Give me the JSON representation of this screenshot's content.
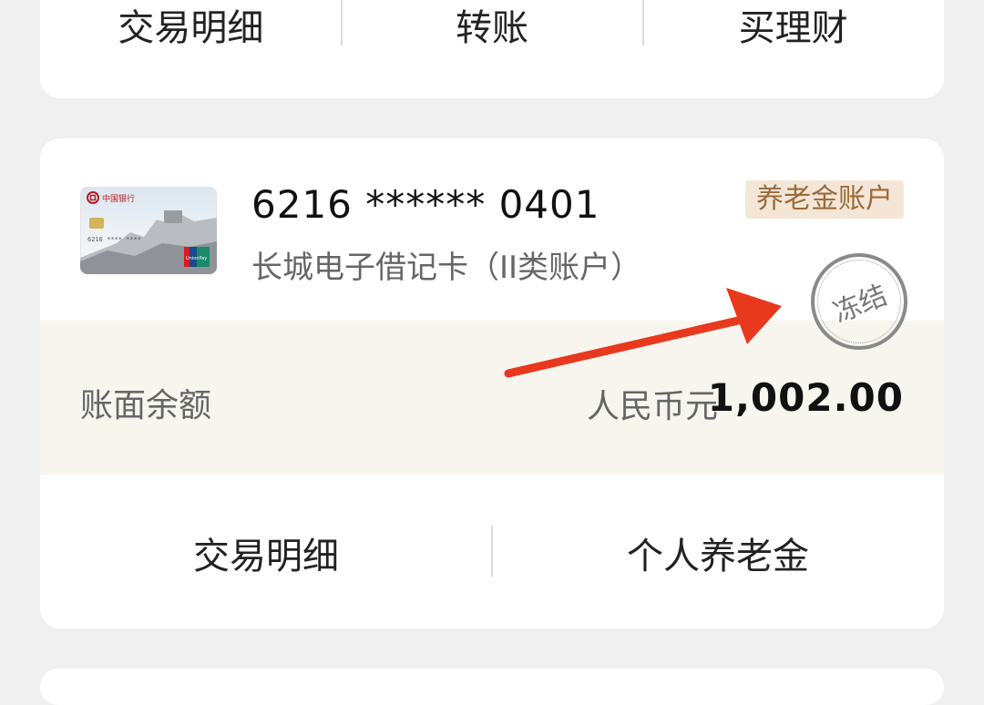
{
  "top_card": {
    "actions": [
      {
        "label": "交易明细"
      },
      {
        "label": "转账"
      },
      {
        "label": "买理财"
      }
    ]
  },
  "account_card": {
    "card_number": "6216 ****** 0401",
    "card_type": "长城电子借记卡（II类账户）",
    "tag": "养老金账户",
    "stamp": "冻结",
    "balance": {
      "label": "账面余额",
      "currency": "人民币元",
      "amount": "1,002.00"
    },
    "actions": [
      {
        "label": "交易明细"
      },
      {
        "label": "个人养老金"
      }
    ],
    "thumbnail_text": {
      "bank": "中国银行",
      "network": "UnionPay"
    }
  },
  "annotation": {
    "arrow_color": "#e8391f"
  }
}
